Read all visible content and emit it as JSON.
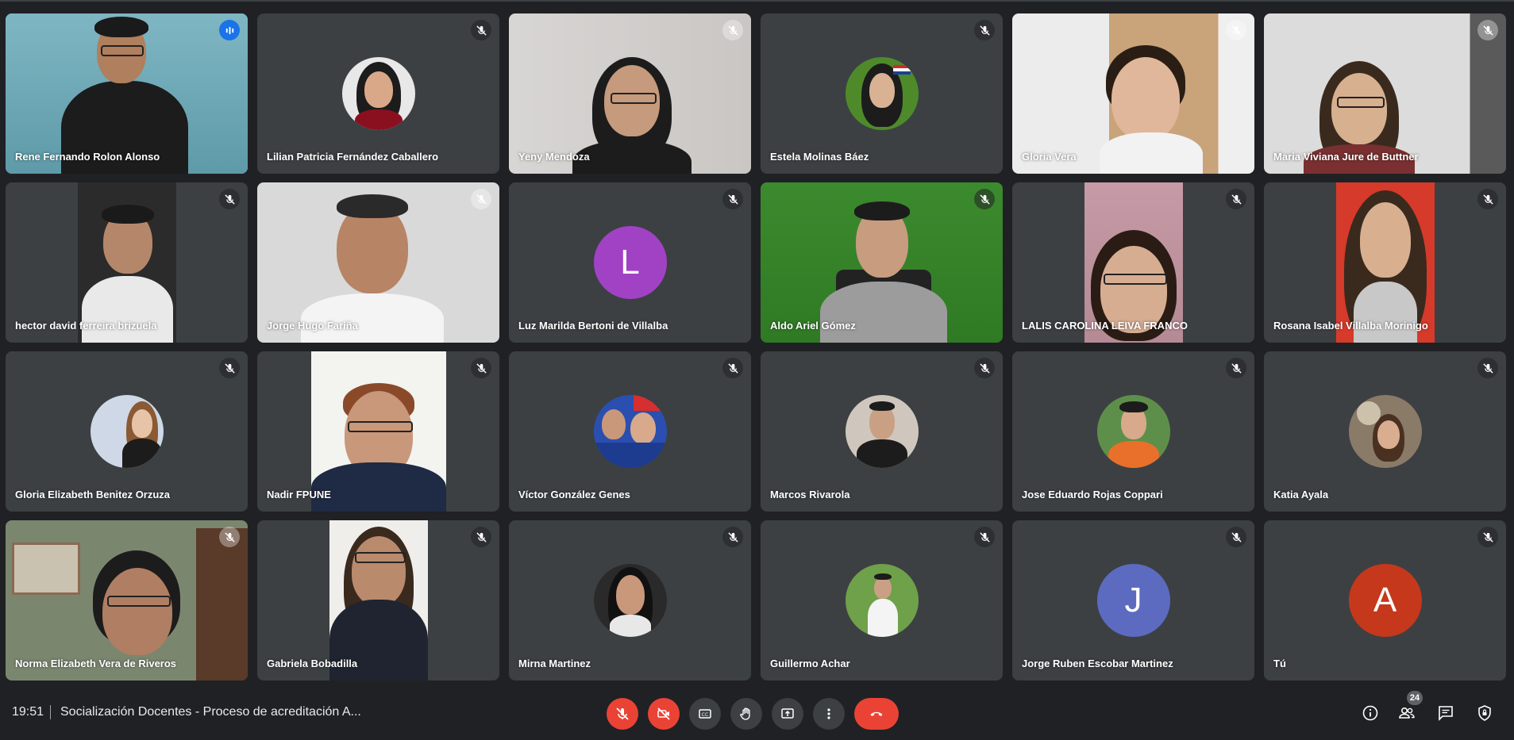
{
  "meeting": {
    "time": "19:51",
    "title": "Socialización Docentes - Proceso de acreditación A...",
    "participant_count": "24"
  },
  "participants": [
    {
      "name": "Rene Fernando Rolon Alonso",
      "kind": "video",
      "speaking": true
    },
    {
      "name": "Lilian Patricia Fernández Caballero",
      "kind": "photo",
      "muted": true
    },
    {
      "name": "Yeny Mendoza",
      "kind": "video",
      "muted": true
    },
    {
      "name": "Estela Molinas Báez",
      "kind": "photo",
      "muted": true
    },
    {
      "name": "Gloria Vera",
      "kind": "video",
      "muted": true
    },
    {
      "name": "Maria Viviana Jure de Buttner",
      "kind": "video",
      "muted": true
    },
    {
      "name": "hector david ferreira brizuela",
      "kind": "video",
      "muted": true
    },
    {
      "name": "Jorge Hugo Fariña",
      "kind": "video",
      "muted": true
    },
    {
      "name": "Luz Marilda Bertoni de Villalba",
      "kind": "letter",
      "letter": "L",
      "color": "#a142c4",
      "muted": true
    },
    {
      "name": "Aldo Ariel Gómez",
      "kind": "video",
      "muted": true
    },
    {
      "name": "LALIS CAROLINA LEIVA FRANCO",
      "kind": "video",
      "muted": true
    },
    {
      "name": "Rosana Isabel Villalba Morinigo",
      "kind": "video",
      "muted": true
    },
    {
      "name": "Gloria Elizabeth Benitez Orzuza",
      "kind": "photo",
      "muted": true
    },
    {
      "name": "Nadir FPUNE",
      "kind": "video",
      "muted": true
    },
    {
      "name": "Víctor González Genes",
      "kind": "photo",
      "muted": true
    },
    {
      "name": "Marcos Rivarola",
      "kind": "photo",
      "muted": true
    },
    {
      "name": "Jose Eduardo Rojas Coppari",
      "kind": "photo",
      "muted": true
    },
    {
      "name": "Katia Ayala",
      "kind": "photo",
      "muted": true
    },
    {
      "name": "Norma Elizabeth Vera de Riveros",
      "kind": "video",
      "muted": true
    },
    {
      "name": "Gabriela Bobadilla",
      "kind": "video",
      "muted": true
    },
    {
      "name": "Mirna Martinez",
      "kind": "photo",
      "muted": true
    },
    {
      "name": "Guillermo Achar",
      "kind": "photo",
      "muted": true
    },
    {
      "name": "Jorge Ruben Escobar Martinez",
      "kind": "letter",
      "letter": "J",
      "color": "#5c6bc0",
      "muted": true
    },
    {
      "name": "Tú",
      "kind": "letter",
      "letter": "A",
      "color": "#c5381b",
      "muted": true
    }
  ],
  "controls": {
    "mic": "mic-off-icon",
    "camera": "camera-off-icon",
    "captions": "closed-captions-icon",
    "raise_hand": "raise-hand-icon",
    "present": "present-screen-icon",
    "more": "more-options-icon",
    "hangup": "hang-up-icon"
  },
  "colors": {
    "background": "#202124",
    "tile": "#3c4043",
    "danger": "#ea4335",
    "speaking": "#1a73e8"
  }
}
